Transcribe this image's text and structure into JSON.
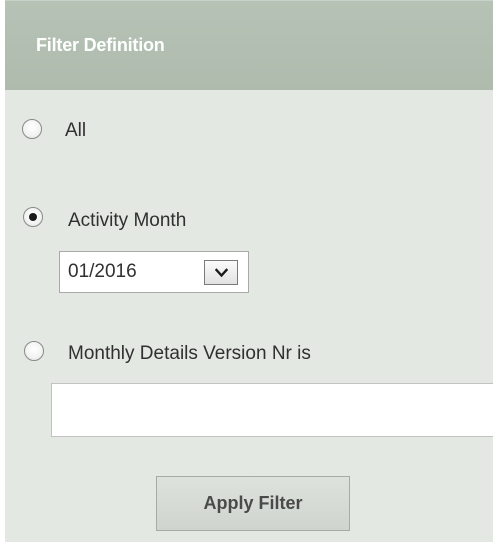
{
  "header": {
    "title": "Filter Definition"
  },
  "options": {
    "all": {
      "label": "All",
      "selected": false
    },
    "activity_month": {
      "label": "Activity Month",
      "selected": true,
      "month_value": "01/2016"
    },
    "version_nr": {
      "label": "Monthly Details Version Nr is",
      "selected": false,
      "input_value": ""
    }
  },
  "actions": {
    "apply_label": "Apply Filter"
  },
  "colors": {
    "header_bg": "#aebbad",
    "panel_bg": "#e4e8e3",
    "button_bg": "#d6dbd5",
    "header_text": "#ffffff"
  },
  "icons": {
    "dropdown": "chevron-down-icon",
    "radio": "radio-button"
  }
}
